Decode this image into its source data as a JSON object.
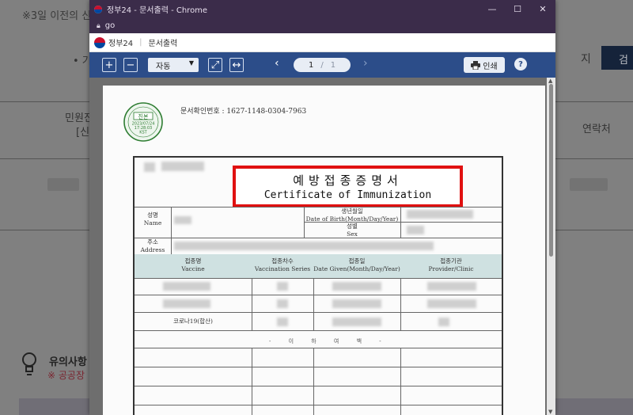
{
  "background": {
    "notice": "※3일 이전의 신",
    "bullet": "• 기",
    "search_suffix": "지",
    "search_button": "검",
    "minwon_line1": "민원진",
    "minwon_line2": "[신",
    "contact_header": "연락처",
    "caution_title": "유의사항",
    "caution_sub": "※ 공공장"
  },
  "window": {
    "title": "정부24 - 문서출력 - Chrome",
    "address": "go",
    "minimize": "—",
    "maximize": "☐",
    "close": "✕"
  },
  "sitebar": {
    "brand": "정부24",
    "page": "문서출력"
  },
  "toolbar": {
    "zoom_in": "+",
    "zoom_out": "−",
    "zoom_value": "자동",
    "fit_page": "⤢",
    "fit_width": "↔",
    "prev": "‹",
    "next": "›",
    "current_page": "1",
    "page_sep": "/",
    "total_pages": "1",
    "print_label": "인쇄",
    "help": "?"
  },
  "document": {
    "doc_number": "문서확인번호 : 1627-1148-0304-7963",
    "stamp_line1": "진본",
    "stamp_date": "2023/07/24",
    "stamp_time": "17:28:03",
    "stamp_kst": "KST",
    "title_ko": "예방접종증명서",
    "title_en": "Certificate of Immunization",
    "name_ko": "성명",
    "name_en": "Name",
    "birth_ko": "생년월일",
    "birth_en": "Date of Birth(Month/Day/Year)",
    "sex_ko": "성별",
    "sex_en": "Sex",
    "address_ko": "주소",
    "address_en": "Address",
    "vaccine_ko": "접종명",
    "vaccine_en": "Vaccine",
    "series_ko": "접종차수",
    "series_en": "Vaccination Series",
    "date_ko": "접종일",
    "date_en": "Date Given(Month/Day/Year)",
    "provider_ko": "접종기관",
    "provider_en": "Provider/Clinic",
    "covid_row": "코로나19(합산)",
    "empty_mark": "- 이 하 여 백 -"
  },
  "colors": {
    "toolbar_bg": "#2c4d89",
    "titlebar_bg": "#3b2c4a",
    "highlight_border": "#e01010",
    "table_header": "#cfe1e1"
  }
}
